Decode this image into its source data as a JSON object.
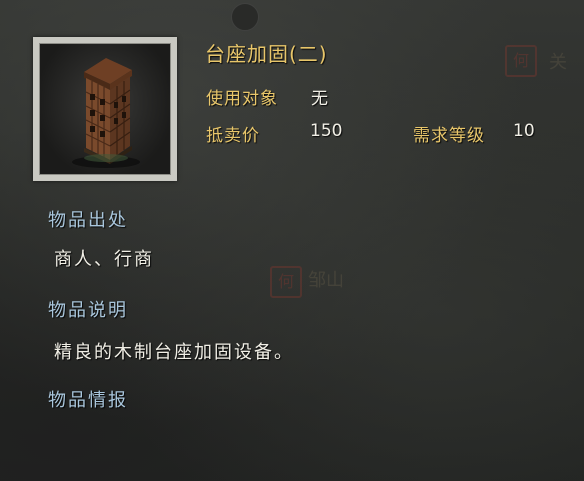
{
  "item": {
    "name": "台座加固(二)",
    "use_target_label": "使用对象",
    "use_target_value": "无",
    "sell_price_label": "抵卖价",
    "sell_price_value": "150",
    "required_level_label": "需求等级",
    "required_level_value": "10"
  },
  "sections": {
    "origin_heading": "物品出处",
    "origin_text": "商人、行商",
    "description_heading": "物品说明",
    "description_text": "精良的木制台座加固设备。",
    "intel_heading": "物品情报"
  },
  "background": {
    "seal_glyph": "何",
    "place_top": "关",
    "place_mid": "邹山"
  },
  "colors": {
    "title": "#e8c66a",
    "value": "#f1efe6",
    "section_heading": "#a9c6dc",
    "frame": "#c9c9c2"
  },
  "icons": {
    "item_icon": "wooden-siege-tower-icon"
  }
}
